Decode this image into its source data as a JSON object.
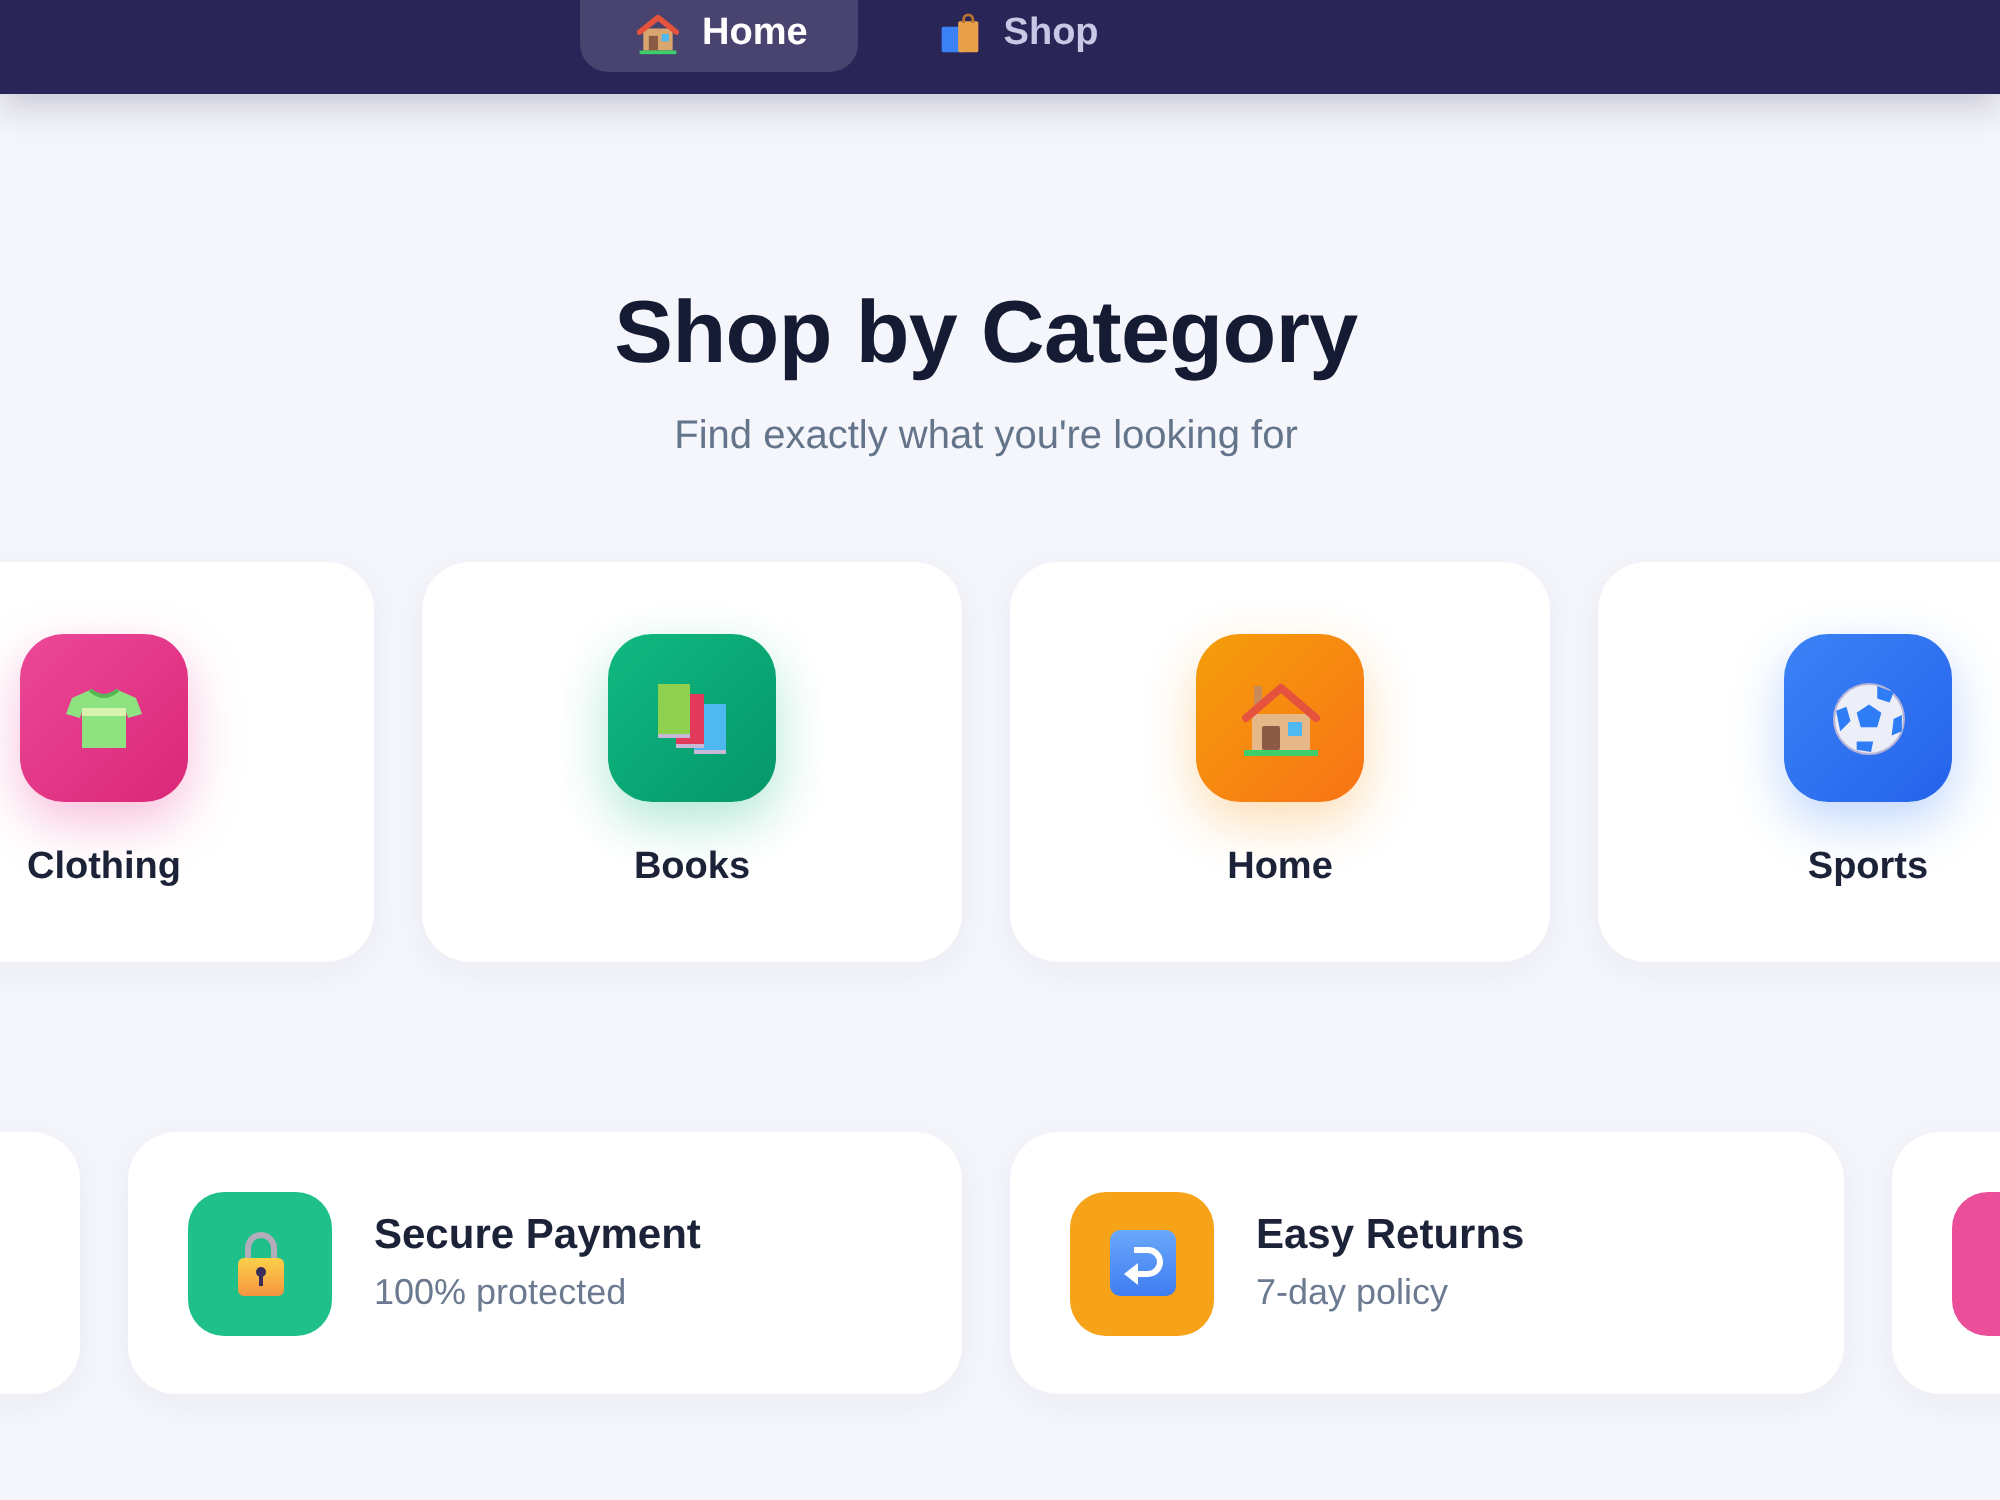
{
  "nav": {
    "items": [
      {
        "label": "Home",
        "selected": true
      },
      {
        "label": "Shop",
        "selected": false
      }
    ]
  },
  "categories_section": {
    "title": "Shop by Category",
    "subtitle": "Find exactly what you're looking for",
    "items": [
      {
        "label": "Clothing"
      },
      {
        "label": "Books"
      },
      {
        "label": "Home"
      },
      {
        "label": "Sports"
      }
    ]
  },
  "features": [
    {
      "kind": "blank"
    },
    {
      "kind": "feature",
      "title": "Secure Payment",
      "subtitle": "100% protected"
    },
    {
      "kind": "feature",
      "title": "Easy Returns",
      "subtitle": "7-day policy"
    },
    {
      "kind": "icon"
    }
  ]
}
